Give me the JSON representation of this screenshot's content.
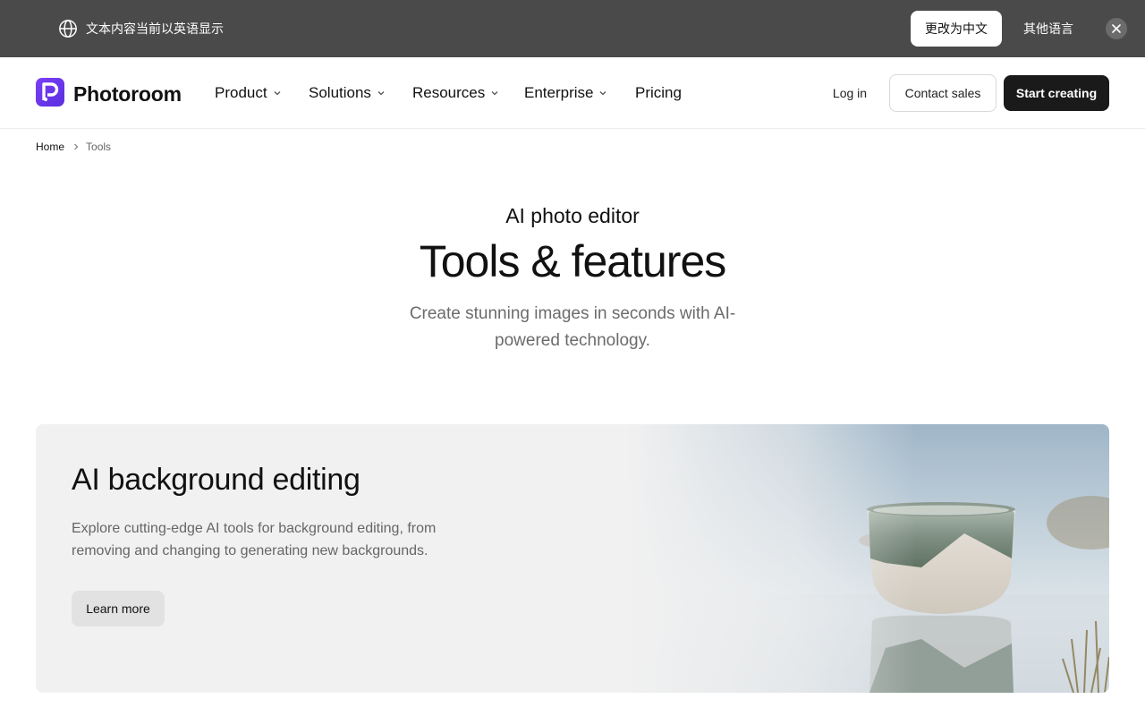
{
  "translate_bar": {
    "message": "文本内容当前以英语显示",
    "switch_label": "更改为中文",
    "other_label": "其他语言",
    "icon": "globe-icon",
    "close_icon": "close-icon"
  },
  "header": {
    "logo_text": "Photoroom",
    "nav": [
      {
        "label": "Product"
      },
      {
        "label": "Solutions"
      },
      {
        "label": "Resources"
      },
      {
        "label": "Enterprise"
      },
      {
        "label": "Pricing"
      }
    ],
    "login_label": "Log in",
    "contact_label": "Contact sales",
    "start_label": "Start creating"
  },
  "breadcrumb": {
    "home": "Home",
    "current": "Tools"
  },
  "hero": {
    "eyebrow": "AI photo editor",
    "title": "Tools & features",
    "subtitle": "Create stunning images in seconds with AI-powered technology."
  },
  "feature_card": {
    "title": "AI background editing",
    "description": "Explore cutting-edge AI tools for background editing, from removing and changing to generating new backgrounds.",
    "button_label": "Learn more"
  },
  "colors": {
    "translate_bar_bg": "#4a4a4a",
    "brand_purple": "#6a3df2",
    "primary_button_bg": "#1a1a1a",
    "card_bg": "#f1f1f1"
  }
}
